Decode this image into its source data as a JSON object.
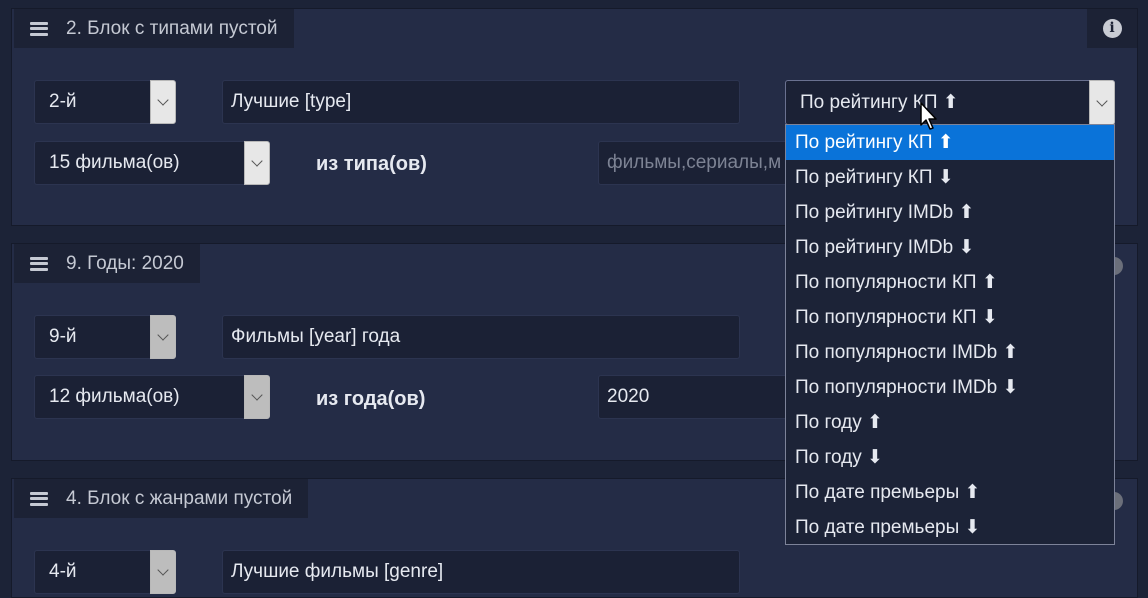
{
  "blocks": [
    {
      "title": "2. Блок с типами пустой",
      "position_value": "2-й",
      "heading_value": "Лучшие [type]",
      "count_value": "15 фильма(ов)",
      "from_label": "из типа(ов)",
      "filter_placeholder": "фильмы,сериалы,м"
    },
    {
      "title": "9. Годы: 2020",
      "position_value": "9-й",
      "heading_value": "Фильмы [year] года",
      "count_value": "12 фильма(ов)",
      "from_label": "из года(ов)",
      "filter_value": "2020"
    },
    {
      "title": "4. Блок с жанрами пустой",
      "position_value": "4-й",
      "heading_value": "Лучшие фильмы [genre]"
    }
  ],
  "sort": {
    "selected": "По рейтингу КП ⬆",
    "options": [
      "По рейтингу КП ⬆",
      "По рейтингу КП ⬇",
      "По рейтингу IMDb ⬆",
      "По рейтингу IMDb ⬇",
      "По популярности КП ⬆",
      "По популярности КП ⬇",
      "По популярности IMDb ⬆",
      "По популярности IMDb ⬇",
      "По году ⬆",
      "По году ⬇",
      "По дате премьеры ⬆",
      "По дате премьеры ⬇"
    ],
    "highlighted_index": 0
  },
  "icons": {
    "drag": "hamburger-icon",
    "info": "info-icon",
    "dropdown": "chevron-down-icon",
    "cursor": "mouse-pointer-icon"
  },
  "colors": {
    "background": "#1c2337",
    "panel": "#242c46",
    "highlight": "#0a73d9"
  }
}
